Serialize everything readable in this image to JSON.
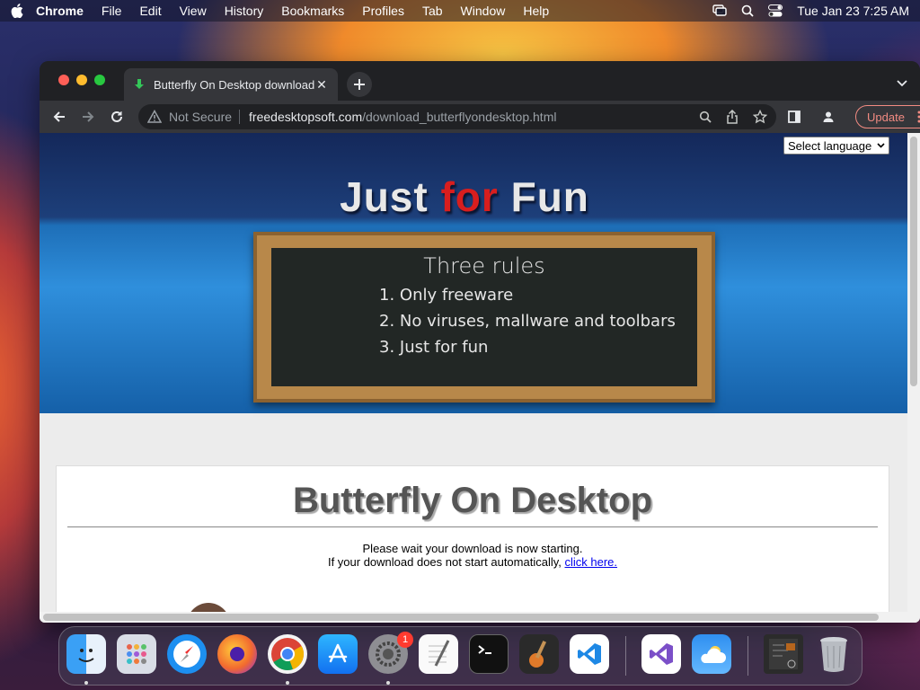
{
  "menubar": {
    "app": "Chrome",
    "items": [
      "File",
      "Edit",
      "View",
      "History",
      "Bookmarks",
      "Profiles",
      "Tab",
      "Window",
      "Help"
    ],
    "clock": "Tue Jan 23  7:25 AM"
  },
  "browser": {
    "tab_title": "Butterfly On Desktop download",
    "security_label": "Not Secure",
    "url_host": "freedesktopsoft.com",
    "url_path": "/download_butterflyondesktop.html",
    "update_label": "Update"
  },
  "page": {
    "language_select": "Select language",
    "headline_just": "Just ",
    "headline_for": "for",
    "headline_fun": " Fun",
    "rules_title": "Three rules",
    "rules": [
      "1. Only freeware",
      "2. No viruses, mallware and toolbars",
      "3. Just for fun"
    ],
    "product_title": "Butterfly On Desktop",
    "wait_message": "Please wait your download is now starting.",
    "fallback_message": "If your download does not start automatically,",
    "fallback_link": "click here."
  },
  "dock": {
    "apps": [
      "Finder",
      "Launchpad",
      "Safari",
      "Firefox",
      "Google Chrome",
      "App Store",
      "System Settings",
      "TextEdit",
      "Terminal",
      "GarageBand",
      "Visual Studio Code",
      "Visual Studio",
      "Weather",
      "Downloads",
      "Trash"
    ],
    "settings_badge": "1"
  },
  "colors": {
    "accent_red": "#d81e1e",
    "link": "#0000ee",
    "update_outline": "#f28b82"
  }
}
